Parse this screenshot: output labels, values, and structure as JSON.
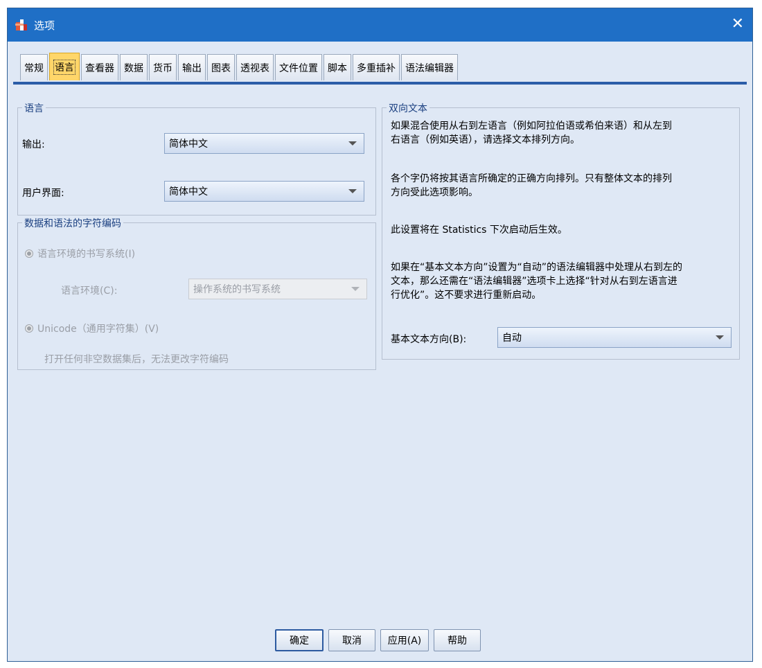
{
  "window": {
    "title": "选项",
    "close_glyph": "✕"
  },
  "tabs": [
    {
      "label": "常规"
    },
    {
      "label": "语言",
      "active": true
    },
    {
      "label": "查看器"
    },
    {
      "label": "数据"
    },
    {
      "label": "货币"
    },
    {
      "label": "输出"
    },
    {
      "label": "图表"
    },
    {
      "label": "透视表"
    },
    {
      "label": "文件位置"
    },
    {
      "label": "脚本"
    },
    {
      "label": "多重插补"
    },
    {
      "label": "语法编辑器"
    }
  ],
  "language": {
    "title": "语言",
    "output_label": "输出:",
    "output_value": "简体中文",
    "ui_label": "用户界面:",
    "ui_value": "简体中文"
  },
  "encoding": {
    "title": "数据和语法的字符编码",
    "locale_radio": "语言环境的书写系统(I)",
    "locale_label": "语言环境(C):",
    "locale_value": "操作系统的书写系统",
    "unicode_radio": "Unicode（通用字符集）(V)",
    "note": "打开任何非空数据集后，无法更改字符编码"
  },
  "bidi": {
    "title": "双向文本",
    "para1_line1": "如果混合使用从右到左语言（例如阿拉伯语或希伯来语）和从左到",
    "para1_line2": "右语言（例如英语），请选择文本排列方向。",
    "para2_line1": "各个字仍将按其语言所确定的正确方向排列。只有整体文本的排列",
    "para2_line2": "方向受此选项影响。",
    "para3": "此设置将在 Statistics 下次启动后生效。",
    "para4_line1": "如果在“基本文本方向”设置为“自动”的语法编辑器中处理从右到左的",
    "para4_line2": "文本，那么还需在“语法编辑器”选项卡上选择“针对从右到左语言进",
    "para4_line3": "行优化”。这不要求进行重新启动。",
    "direction_label": "基本文本方向(B):",
    "direction_value": "自动"
  },
  "buttons": {
    "ok": "确定",
    "cancel": "取消",
    "apply": "应用(A)",
    "help": "帮助"
  }
}
